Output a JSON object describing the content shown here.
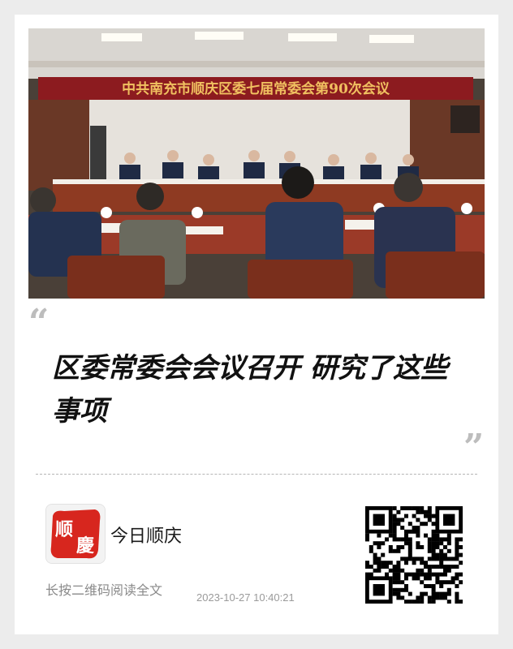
{
  "photo": {
    "banner_text": "中共南充市顺庆区委七届常委会第90次会议",
    "colors": {
      "banner_bg": "#8c1b1f",
      "banner_text": "#f0c060",
      "table": "#9b3a28",
      "wall": "#e6e2dc"
    }
  },
  "quote": {
    "open": "“",
    "close": "”"
  },
  "headline": "区委常委会会议召开 研究了这些事项",
  "account": {
    "logo_text": [
      "顺",
      "慶"
    ],
    "name": "今日顺庆",
    "logo_bg": "#d7261e"
  },
  "footer": {
    "hint": "长按二维码阅读全文",
    "timestamp": "2023-10-27 10:40:21"
  },
  "qr_code": {
    "icon": "qr-code-icon"
  }
}
